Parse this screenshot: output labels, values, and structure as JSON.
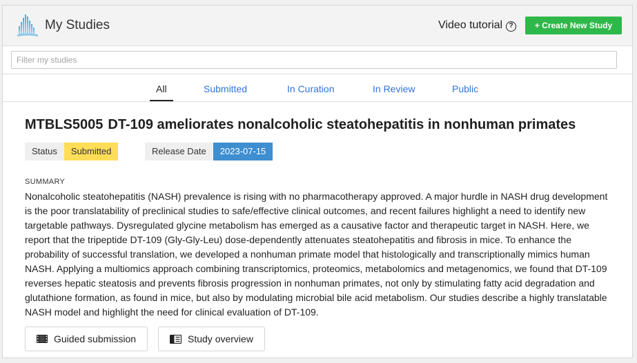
{
  "header": {
    "app_title": "My Studies",
    "video_tutorial": "Video tutorial",
    "help_icon": "?",
    "create_button": "+ Create New Study",
    "accent_color": "#2fb84a"
  },
  "filter": {
    "placeholder": "Filter my studies",
    "value": ""
  },
  "tabs": [
    {
      "label": "All",
      "active": true
    },
    {
      "label": "Submitted",
      "active": false
    },
    {
      "label": "In Curation",
      "active": false
    },
    {
      "label": "In Review",
      "active": false
    },
    {
      "label": "Public",
      "active": false
    }
  ],
  "study": {
    "accession": "MTBLS5005",
    "title": "DT-109 ameliorates nonalcoholic steatohepatitis in nonhuman primates",
    "status_label": "Status",
    "status_value": "Submitted",
    "status_color": "#ffdd57",
    "release_label": "Release Date",
    "release_value": "2023-07-15",
    "release_color": "#3e8ed0",
    "summary_heading": "SUMMARY",
    "summary": "Nonalcoholic steatohepatitis (NASH) prevalence is rising with no pharmacotherapy approved. A major hurdle in NASH drug development is the poor translatability of preclinical studies to safe/effective clinical outcomes, and recent failures highlight a need to identify new targetable pathways. Dysregulated glycine metabolism has emerged as a causative factor and therapeutic target in NASH. Here, we report that the tripeptide DT-109 (Gly-Gly-Leu) dose-dependently attenuates steatohepatitis and fibrosis in mice. To enhance the probability of successful translation, we developed a nonhuman primate model that histologically and transcriptionally mimics human NASH. Applying a multiomics approach combining transcriptomics, proteomics, metabolomics and metagenomics, we found that DT-109 reverses hepatic steatosis and prevents fibrosis progression in nonhuman primates, not only by stimulating fatty acid degradation and glutathione formation, as found in mice, but also by modulating microbial bile acid metabolism. Our studies describe a highly translatable NASH model and highlight the need for clinical evaluation of DT-109.",
    "guided_button": "Guided submission",
    "overview_button": "Study overview"
  },
  "icons": {
    "logo": "metabolights-logo",
    "guided": "film-icon",
    "overview": "book-icon"
  }
}
